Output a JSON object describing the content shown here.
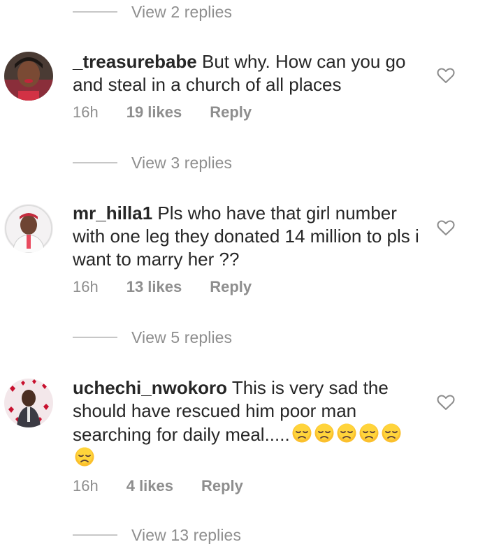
{
  "replies": [
    "View 2 replies",
    "View 3 replies",
    "View 5 replies",
    "View 13 replies"
  ],
  "comments": [
    {
      "username": "_treasurebabe",
      "text": "But why. How can you go and steal in a church of all places",
      "time": "16h",
      "likes": "19 likes",
      "reply": "Reply"
    },
    {
      "username": "mr_hilla1",
      "text": "Pls who have that girl number with one leg they donated 14 million to pls i want to marry her ??",
      "time": "16h",
      "likes": "13 likes",
      "reply": "Reply"
    },
    {
      "username": "uchechi_nwokoro",
      "text": "This is very sad the should have rescued him poor man searching for daily meal.....",
      "emoji_count": 6,
      "time": "16h",
      "likes": "4 likes",
      "reply": "Reply"
    }
  ],
  "icons": {
    "like": "heart-outline-icon",
    "emoji": "disappointed-face-emoji"
  }
}
